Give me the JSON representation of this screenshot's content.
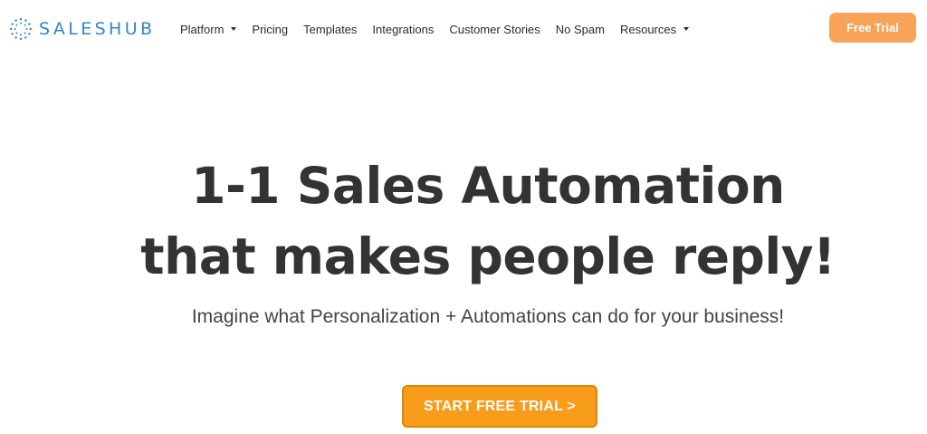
{
  "brand": {
    "logo_icon": "saleshub-burst-logo-icon",
    "name": "SALESHUB",
    "color": "#2f86c8"
  },
  "nav": {
    "items": [
      {
        "label": "Platform",
        "has_dropdown": true
      },
      {
        "label": "Pricing",
        "has_dropdown": false
      },
      {
        "label": "Templates",
        "has_dropdown": false
      },
      {
        "label": "Integrations",
        "has_dropdown": false
      },
      {
        "label": "Customer Stories",
        "has_dropdown": false
      },
      {
        "label": "No Spam",
        "has_dropdown": false
      },
      {
        "label": "Resources",
        "has_dropdown": true
      }
    ],
    "dropdown_icon": "caret-down-icon"
  },
  "header": {
    "cta_label": "Free Trial",
    "cta_color": "#f7a35a"
  },
  "hero": {
    "title_line1": "1-1 Sales Automation",
    "title_line2": "that makes people reply!",
    "subtitle": "Imagine what Personalization + Automations can do for your business!",
    "cta_label": "START FREE TRIAL >",
    "cta_color": "#f89c1c"
  }
}
